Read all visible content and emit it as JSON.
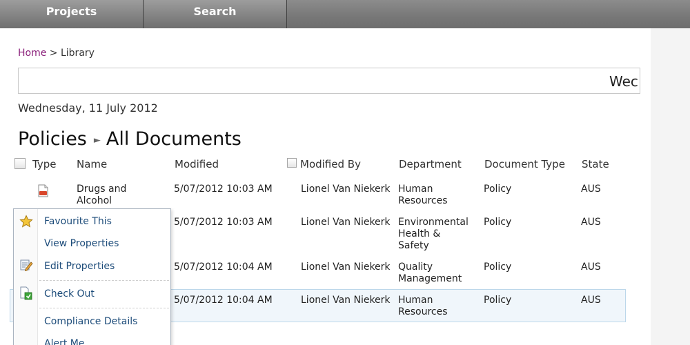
{
  "nav": {
    "tabs": [
      {
        "label": "Projects"
      },
      {
        "label": "Search"
      }
    ]
  },
  "breadcrumb": {
    "home": "Home",
    "separator": ">",
    "current": "Library"
  },
  "ticker": {
    "text": "Wec"
  },
  "date": "Wednesday, 11 July 2012",
  "page_title": {
    "list": "Policies",
    "view": "All Documents"
  },
  "table": {
    "headers": {
      "type": "Type",
      "name": "Name",
      "modified": "Modified",
      "modified_by": "Modified By",
      "department": "Department",
      "document_type": "Document Type",
      "state": "State"
    },
    "rows": [
      {
        "name": "Drugs and Alcohol",
        "modified": "5/07/2012 10:03 AM",
        "modified_by": "Lionel Van Niekerk",
        "department": "Human Resources",
        "document_type": "Policy",
        "state": "AUS"
      },
      {
        "name": "",
        "modified": "5/07/2012 10:03 AM",
        "modified_by": "Lionel Van Niekerk",
        "department": "Environmental Health & Safety",
        "document_type": "Policy",
        "state": "AUS"
      },
      {
        "name": "",
        "modified": "5/07/2012 10:04 AM",
        "modified_by": "Lionel Van Niekerk",
        "department": "Quality Management",
        "document_type": "Policy",
        "state": "AUS"
      },
      {
        "name": "",
        "modified": "5/07/2012 10:04 AM",
        "modified_by": "Lionel Van Niekerk",
        "department": "Human Resources",
        "document_type": "Policy",
        "state": "AUS"
      }
    ]
  },
  "context_menu": {
    "items": [
      {
        "label": "Favourite This",
        "icon": "star-icon"
      },
      {
        "label": "View Properties",
        "icon": ""
      },
      {
        "label": "Edit Properties",
        "icon": "edit-properties-icon"
      },
      {
        "label": "Check Out",
        "icon": "check-out-icon"
      },
      {
        "label": "Compliance Details",
        "icon": ""
      },
      {
        "label": "Alert Me",
        "icon": ""
      }
    ]
  },
  "colors": {
    "nav_bg": "#777777",
    "link": "#8a1f7a",
    "menu_text": "#1d4c7a",
    "selected_row": "#f0f6fb"
  }
}
